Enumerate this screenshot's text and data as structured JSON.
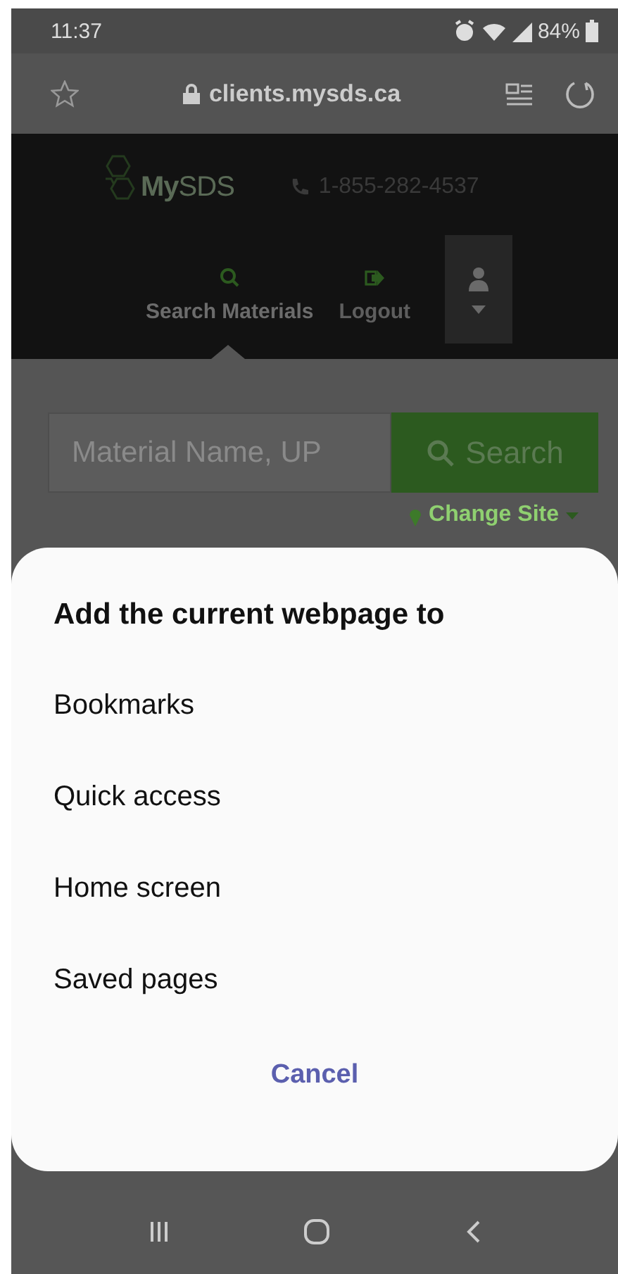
{
  "status_bar": {
    "time": "11:37",
    "battery": "84%"
  },
  "browser_bar": {
    "url": "clients.mysds.ca"
  },
  "site_header": {
    "logo": "**My**SDS",
    "phone": "1-855-282-4537",
    "nav": [
      {
        "label": "Search Materials",
        "kind": "search",
        "selected": true
      },
      {
        "label": "Logout",
        "kind": "logout",
        "selected": false
      }
    ]
  },
  "search": {
    "placeholder": "Material Name, UP",
    "button": "Search",
    "change_site": "Change Site"
  },
  "sheet": {
    "title": "Add the current webpage to",
    "options": [
      "Bookmarks",
      "Quick access",
      "Home screen",
      "Saved pages"
    ],
    "cancel": "Cancel"
  }
}
